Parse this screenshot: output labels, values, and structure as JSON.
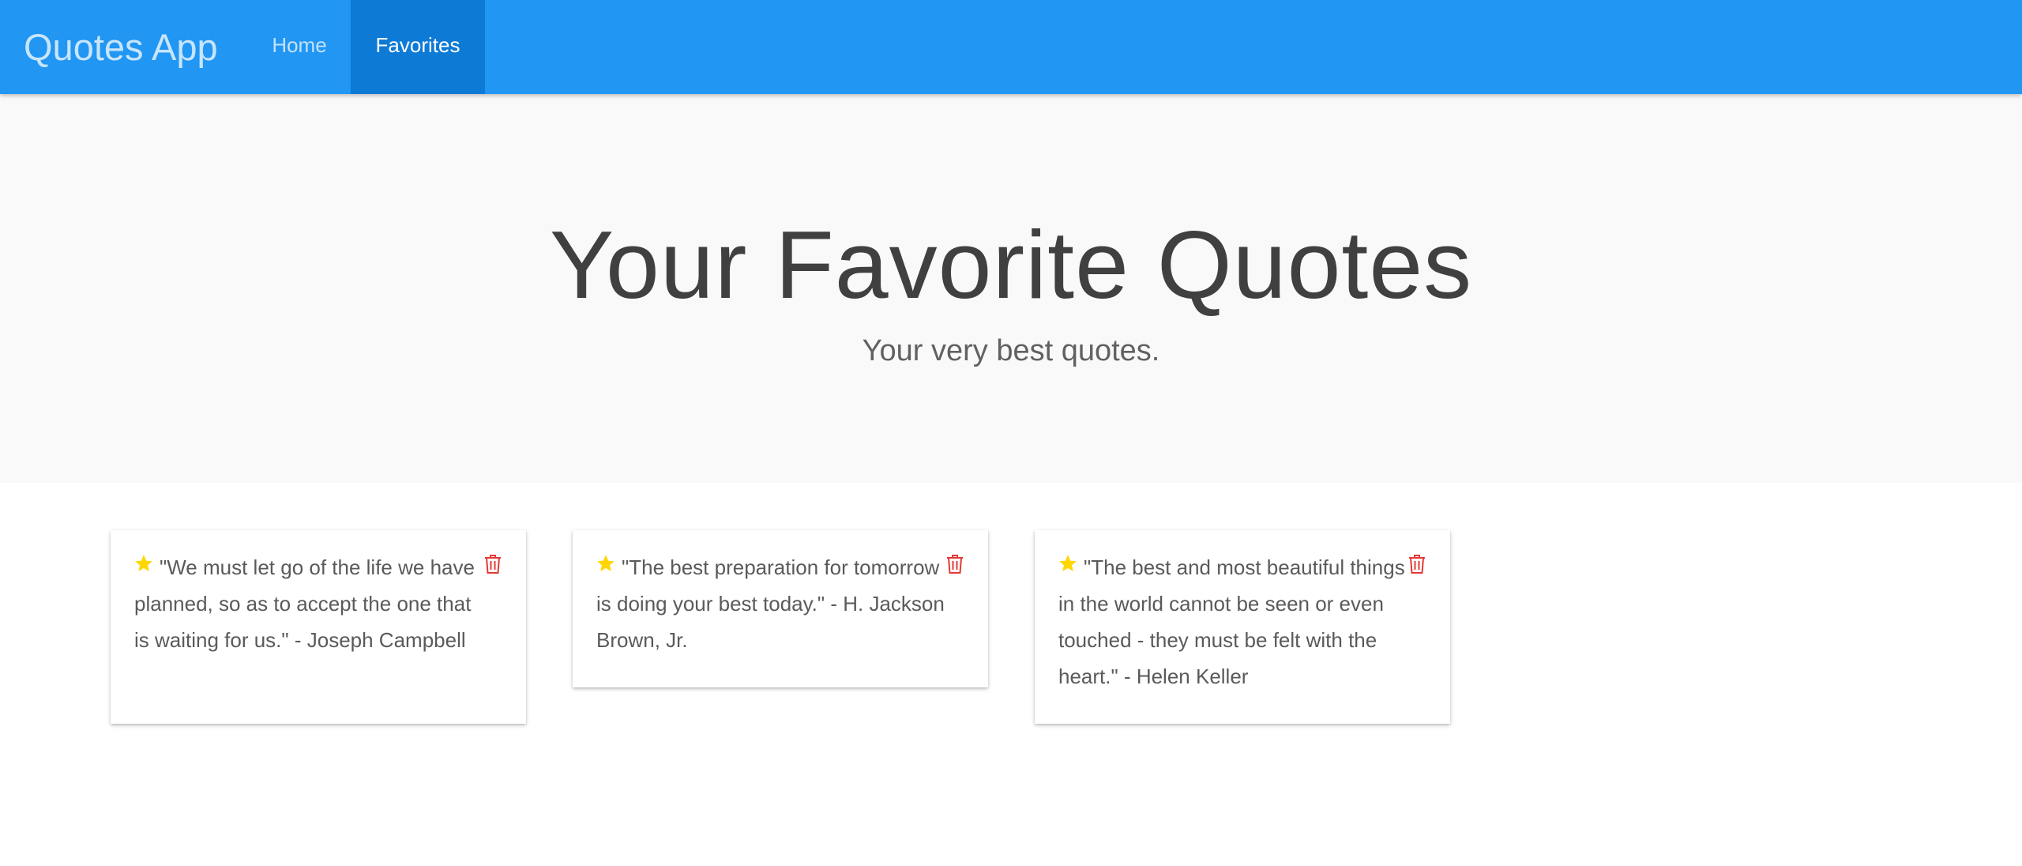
{
  "navbar": {
    "brand": "Quotes App",
    "items": [
      {
        "label": "Home",
        "active": false
      },
      {
        "label": "Favorites",
        "active": true
      }
    ],
    "color": "#2196f3",
    "active_color": "#0d7ad6"
  },
  "hero": {
    "title": "Your Favorite Quotes",
    "subtitle": "Your very best quotes."
  },
  "quotes": [
    {
      "text": "\"We must let go of the life we have planned, so as to accept the one that is waiting for us.\" - Joseph Campbell",
      "icon": "star-icon",
      "action_icon": "trash-icon"
    },
    {
      "text": "\"The best preparation for tomorrow is doing your best today.\" - H. Jackson Brown, Jr.",
      "icon": "star-icon",
      "action_icon": "trash-icon"
    },
    {
      "text": "\"The best and most beautiful things in the world cannot be seen or even touched - they must be felt with the heart.\" - Helen Keller",
      "icon": "star-icon",
      "action_icon": "trash-icon"
    }
  ],
  "colors": {
    "star": "#ffd600",
    "trash": "#e53935"
  }
}
